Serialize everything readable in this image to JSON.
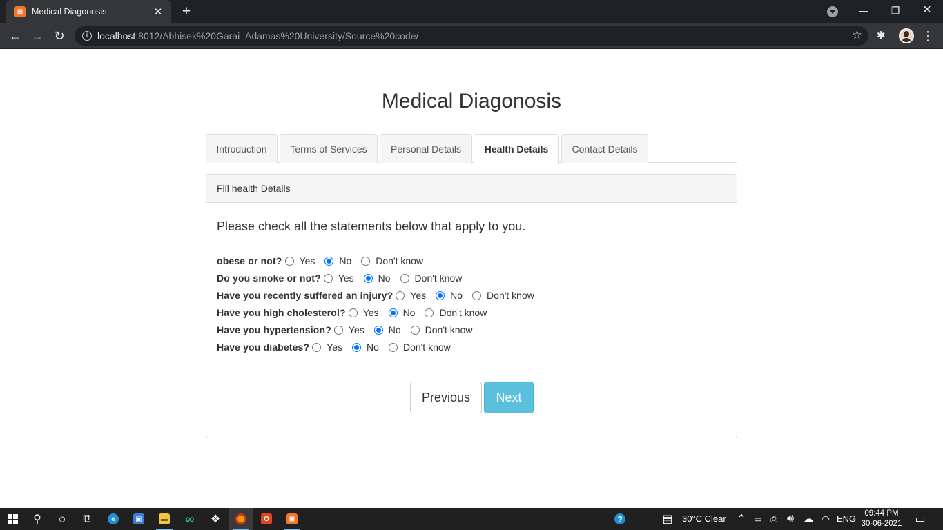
{
  "browser": {
    "tab_title": "Medical Diagonosis",
    "tab_favicon": "xampp-icon",
    "url_host": "localhost",
    "url_rest": ":8012/Abhisek%20Garai_Adamas%20University/Source%20code/"
  },
  "page": {
    "title": "Medical Diagonosis",
    "tabs": [
      {
        "label": "Introduction",
        "active": false
      },
      {
        "label": "Terms of Services",
        "active": false
      },
      {
        "label": "Personal Details",
        "active": false
      },
      {
        "label": "Health Details",
        "active": true
      },
      {
        "label": "Contact Details",
        "active": false
      }
    ],
    "panel": {
      "heading": "Fill health Details",
      "instruction": "Please check all the statements below that apply to you.",
      "options": [
        "Yes",
        "No",
        "Don't know"
      ],
      "questions": [
        {
          "label": "obese or not?",
          "selected": "No"
        },
        {
          "label": "Do you smoke or not?",
          "selected": "No"
        },
        {
          "label": "Have you recently suffered an injury?",
          "selected": "No"
        },
        {
          "label": "Have you high cholesterol?",
          "selected": "No"
        },
        {
          "label": "Have you hypertension?",
          "selected": "No"
        },
        {
          "label": "Have you diabetes?",
          "selected": "No"
        }
      ],
      "previous_label": "Previous",
      "next_label": "Next"
    }
  },
  "taskbar": {
    "weather": "30°C  Clear",
    "language": "ENG",
    "time": "09:44 PM",
    "date": "30-06-2021"
  },
  "colors": {
    "next_button": "#5bc0de",
    "radio_checked": "#0075ff",
    "browser_dark": "#202124"
  }
}
